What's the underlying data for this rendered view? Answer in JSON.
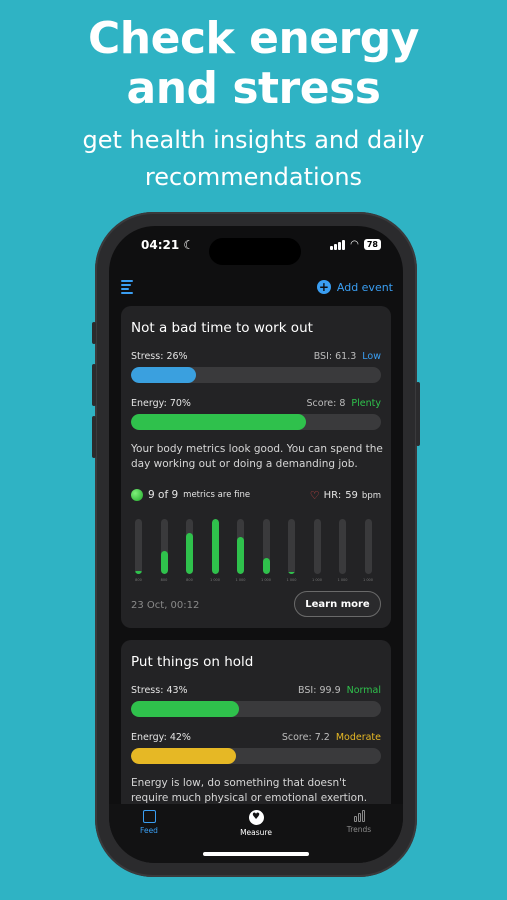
{
  "promo": {
    "headline_line1": "Check energy",
    "headline_line2": "and stress",
    "subline_line1": "get health insights and daily",
    "subline_line2": "recommendations"
  },
  "status_bar": {
    "time": "04:21",
    "battery": "78"
  },
  "toolbar": {
    "add_event_label": "Add event"
  },
  "cards": [
    {
      "title": "Not a bad time to work out",
      "stress": {
        "label": "Stress:",
        "percent": "26%",
        "metric_label": "BSI:",
        "metric_value": "61.3",
        "level": "Low",
        "level_color": "#3a9ef2",
        "fill": 0.26,
        "color": "#3aa0df"
      },
      "energy": {
        "label": "Energy:",
        "percent": "70%",
        "metric_label": "Score:",
        "metric_value": "8",
        "level": "Plenty",
        "level_color": "#2fc14c",
        "fill": 0.7,
        "color": "#2fc14c"
      },
      "description": "Your body metrics look good. You can spend the day working out or doing a demanding job.",
      "metrics_summary": "9 of 9",
      "metrics_summary_suffix": "metrics are fine",
      "hr_label": "HR:",
      "hr_value": "59",
      "hr_unit": "bpm",
      "mini_bars": [
        {
          "label": "800",
          "fill": 0.05
        },
        {
          "label": "800",
          "fill": 0.42
        },
        {
          "label": "800",
          "fill": 0.75
        },
        {
          "label": "1 000",
          "fill": 1.0
        },
        {
          "label": "1 000",
          "fill": 0.68
        },
        {
          "label": "1 000",
          "fill": 0.3
        },
        {
          "label": "1 000",
          "fill": 0.03
        },
        {
          "label": "1 000",
          "fill": 0.0
        },
        {
          "label": "1 000",
          "fill": 0.0
        },
        {
          "label": "1 000",
          "fill": 0.0
        }
      ],
      "date": "23 Oct, 00:12",
      "button_label": "Learn more"
    },
    {
      "title": "Put things on hold",
      "stress": {
        "label": "Stress:",
        "percent": "43%",
        "metric_label": "BSI:",
        "metric_value": "99.9",
        "level": "Normal",
        "level_color": "#2fc14c",
        "fill": 0.43,
        "color": "#2fc14c"
      },
      "energy": {
        "label": "Energy:",
        "percent": "42%",
        "metric_label": "Score:",
        "metric_value": "7.2",
        "level": "Moderate",
        "level_color": "#e6b825",
        "fill": 0.42,
        "color": "#e6b825"
      },
      "description": "Energy is low, do something that doesn't require much physical or emotional exertion."
    }
  ],
  "tabs": [
    {
      "label": "Feed",
      "icon": "feed-icon",
      "active": true
    },
    {
      "label": "Measure",
      "icon": "heart-icon",
      "active": false
    },
    {
      "label": "Trends",
      "icon": "trends-icon",
      "active": false
    }
  ],
  "colors": {
    "background": "#2fb3c4",
    "accent": "#3a9ef2",
    "card": "#232325"
  }
}
